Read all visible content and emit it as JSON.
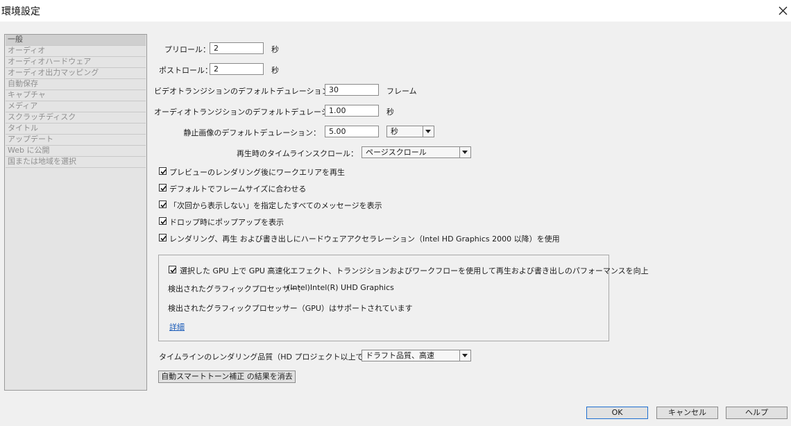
{
  "window": {
    "title": "環境設定"
  },
  "sidebar": {
    "items": [
      {
        "label": "一般",
        "selected": true
      },
      {
        "label": "オーディオ"
      },
      {
        "label": "オーディオハードウェア"
      },
      {
        "label": "オーディオ出力マッピング"
      },
      {
        "label": "自動保存"
      },
      {
        "label": "キャプチャ"
      },
      {
        "label": "メディア"
      },
      {
        "label": "スクラッチディスク"
      },
      {
        "label": "タイトル"
      },
      {
        "label": "アップデート"
      },
      {
        "label": "Web に公開"
      },
      {
        "label": "国または地域を選択"
      }
    ]
  },
  "general": {
    "preroll": {
      "label": "プリロール：",
      "value": "2",
      "unit": "秒"
    },
    "postroll": {
      "label": "ポストロール：",
      "value": "2",
      "unit": "秒"
    },
    "video_transition": {
      "label": "ビデオトランジションのデフォルトデュレーション：",
      "value": "30",
      "unit": "フレーム"
    },
    "audio_transition": {
      "label": "オーディオトランジションのデフォルトデュレーション：",
      "value": "1.00",
      "unit": "秒"
    },
    "still_image": {
      "label": "静止画像のデフォルトデュレーション：",
      "value": "5.00",
      "unit_select": "秒"
    },
    "timeline_scroll": {
      "label": "再生時のタイムラインスクロール：",
      "value": "ページスクロール"
    },
    "checkboxes": [
      {
        "label": "プレビューのレンダリング後にワークエリアを再生",
        "checked": true
      },
      {
        "label": "デフォルトでフレームサイズに合わせる",
        "checked": true
      },
      {
        "label": "「次回から表示しない」を指定したすべてのメッセージを表示",
        "checked": true
      },
      {
        "label": "ドロップ時にポップアップを表示",
        "checked": true
      },
      {
        "label": "レンダリング、再生 および書き出しにハードウェアアクセラレーション（Intel HD Graphics 2000 以降）を使用",
        "checked": true
      }
    ],
    "gpu": {
      "checkbox_label": "選択した GPU 上で GPU 高速化エフェクト、トランジションおよびワークフローを使用して再生および書き出しのパフォーマンスを向上",
      "checked": true,
      "detected_label": "検出されたグラフィックプロセッサー：",
      "detected_value": "(Intel)Intel(R) UHD Graphics",
      "support_text": "検出されたグラフィックプロセッサー（GPU）はサポートされています",
      "details_link": "詳細"
    },
    "render_quality": {
      "label": "タイムラインのレンダリング品質（HD プロジェクト以上で有効）：",
      "value": "ドラフト品質、高速"
    },
    "clear_button": "自動スマートトーン補正 の結果を消去"
  },
  "footer": {
    "ok": "OK",
    "cancel": "キャンセル",
    "help": "ヘルプ"
  },
  "colors": {
    "link": "#1a5bb8",
    "ok_border": "#1f6fd0"
  },
  "icons": {
    "close": "close-icon",
    "checkbox": "checkbox-checked-icon",
    "dropdown": "chevron-down-icon"
  }
}
